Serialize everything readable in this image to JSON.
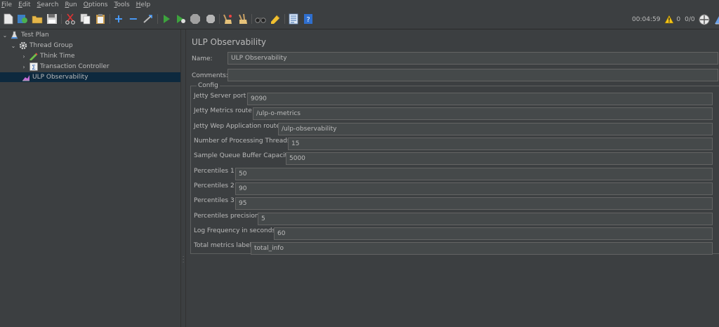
{
  "menu": [
    {
      "mnemonic": "F",
      "rest": "ile"
    },
    {
      "mnemonic": "E",
      "rest": "dit"
    },
    {
      "mnemonic": "S",
      "rest": "earch"
    },
    {
      "mnemonic": "R",
      "rest": "un"
    },
    {
      "mnemonic": "O",
      "rest": "ptions"
    },
    {
      "mnemonic": "T",
      "rest": "ools"
    },
    {
      "mnemonic": "H",
      "rest": "elp"
    }
  ],
  "toolbar": {
    "timer": "00:04:59",
    "warnings": "0",
    "threads": "0/0",
    "colors": {
      "run": "#3da33d",
      "add": "#4a9eff",
      "stop": "#a0a0a0"
    }
  },
  "tree": {
    "test_plan": "Test Plan",
    "thread_group": "Thread Group",
    "think_time": "Think Time",
    "transaction_controller": "Transaction Controller",
    "ulp": "ULP Observability"
  },
  "main": {
    "title": "ULP Observability",
    "name_label": "Name:",
    "name_value": "ULP Observability",
    "comments_label": "Comments:",
    "comments_value": "",
    "config_legend": "Config",
    "fields": {
      "jetty_port_label": "Jetty Server port",
      "jetty_port_value": "9090",
      "metrics_route_label": "Jetty Metrics route",
      "metrics_route_value": "/ulp-o-metrics",
      "app_route_label": "Jetty Wep Application route",
      "app_route_value": "/ulp-observability",
      "threads_label": "Number of Processing Threads",
      "threads_value": "15",
      "queue_label": "Sample Queue Buffer Capacity",
      "queue_value": "5000",
      "p1_label": "Percentiles 1",
      "p1_value": "50",
      "p2_label": "Percentiles 2",
      "p2_value": "90",
      "p3_label": "Percentiles 3",
      "p3_value": "95",
      "precision_label": "Percentiles precision",
      "precision_value": "5",
      "logfreq_label": "Log Frequency in seconds",
      "logfreq_value": "60",
      "total_label": "Total metrics label",
      "total_value": "total_info"
    }
  }
}
